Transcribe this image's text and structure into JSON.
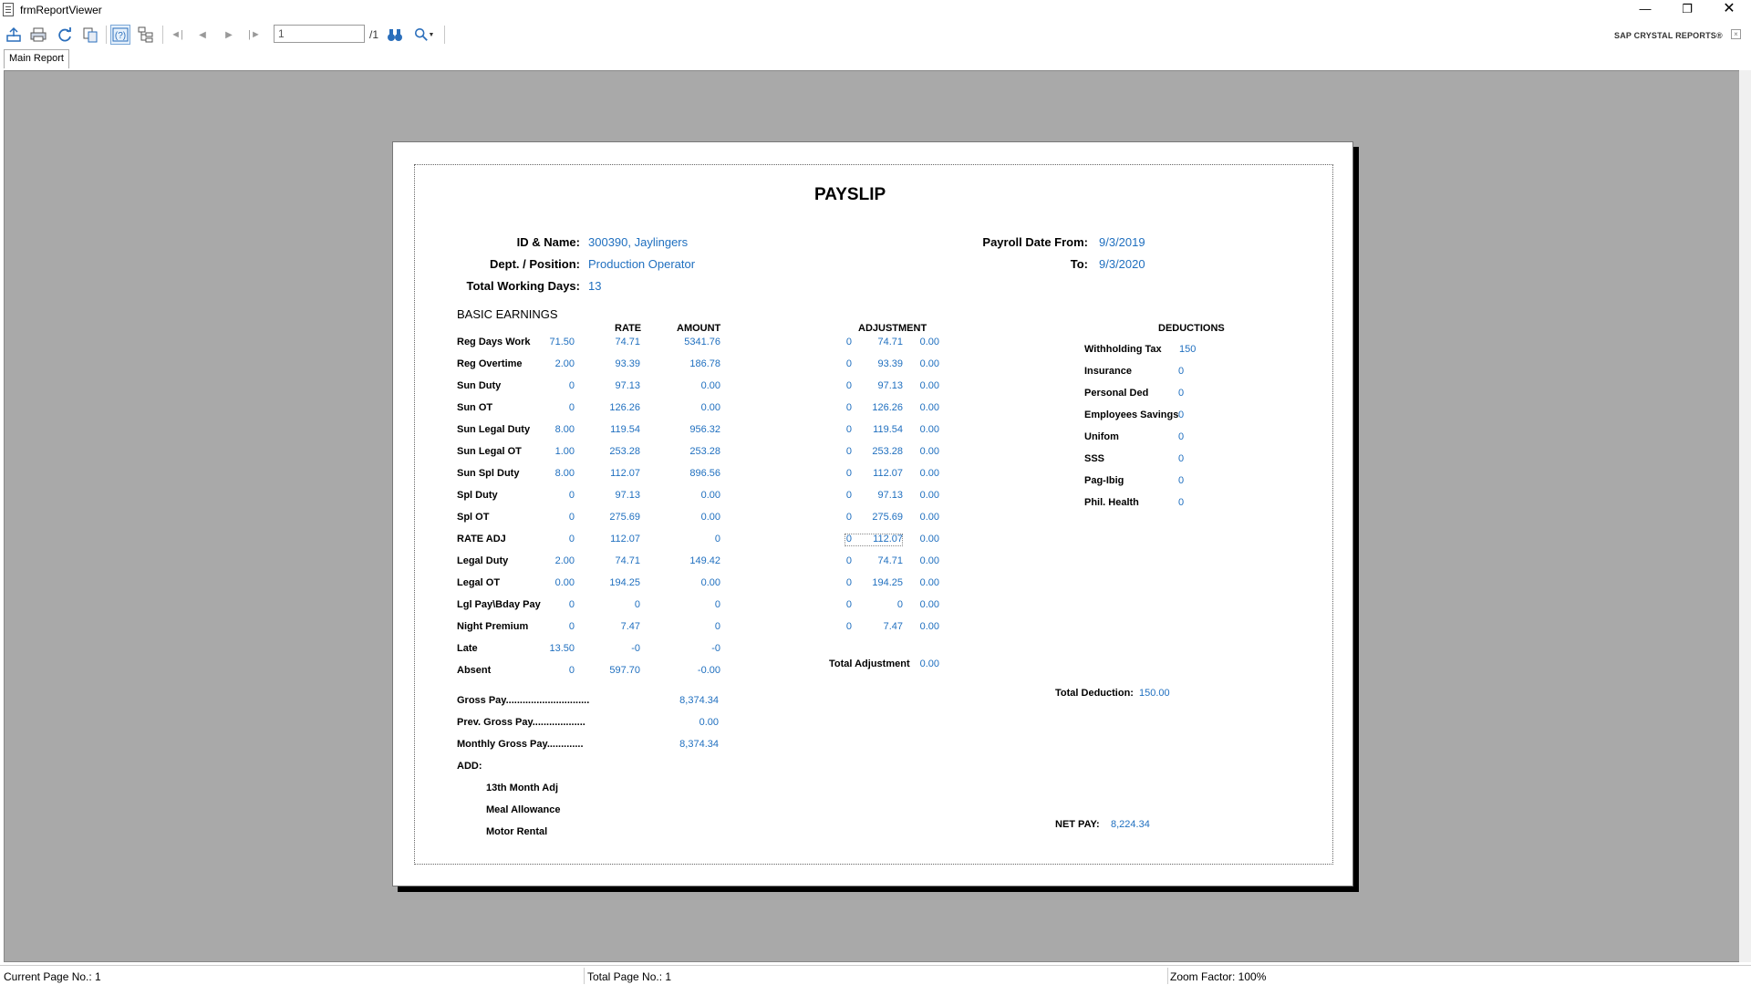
{
  "window": {
    "title": "frmReportViewer"
  },
  "toolbar": {
    "page_value": "1",
    "page_total": "/1",
    "brand": "SAP CRYSTAL REPORTS®"
  },
  "tabs": [
    {
      "label": "Main Report"
    }
  ],
  "report": {
    "title": "PAYSLIP",
    "header": {
      "id_name_label": "ID & Name:",
      "id_name_value": "300390, Jaylingers",
      "dept_label": "Dept. / Position:",
      "dept_value": "Production Operator",
      "days_label": "Total Working Days:",
      "days_value": "13",
      "date_from_label": "Payroll Date From:",
      "date_from_value": "9/3/2019",
      "date_to_label": "To:",
      "date_to_value": "9/3/2020"
    },
    "section_basic": "BASIC EARNINGS",
    "col_rate": "RATE",
    "col_amount": "AMOUNT",
    "col_adjustment": "ADJUSTMENT",
    "col_deductions": "DEDUCTIONS",
    "earnings": [
      {
        "label": "Reg Days  Work",
        "qty": "71.50",
        "rate": "74.71",
        "amount": "5341.76",
        "adj_qty": "0",
        "adj_rate": "74.71",
        "adj_amt": "0.00"
      },
      {
        "label": "Reg Overtime",
        "qty": "2.00",
        "rate": "93.39",
        "amount": "186.78",
        "adj_qty": "0",
        "adj_rate": "93.39",
        "adj_amt": "0.00"
      },
      {
        "label": "Sun Duty",
        "qty": "0",
        "rate": "97.13",
        "amount": "0.00",
        "adj_qty": "0",
        "adj_rate": "97.13",
        "adj_amt": "0.00"
      },
      {
        "label": "Sun OT",
        "qty": "0",
        "rate": "126.26",
        "amount": "0.00",
        "adj_qty": "0",
        "adj_rate": "126.26",
        "adj_amt": "0.00"
      },
      {
        "label": "Sun Legal Duty",
        "qty": "8.00",
        "rate": "119.54",
        "amount": "956.32",
        "adj_qty": "0",
        "adj_rate": "119.54",
        "adj_amt": "0.00"
      },
      {
        "label": "Sun Legal OT",
        "qty": "1.00",
        "rate": "253.28",
        "amount": "253.28",
        "adj_qty": "0",
        "adj_rate": "253.28",
        "adj_amt": "0.00"
      },
      {
        "label": "Sun Spl Duty",
        "qty": "8.00",
        "rate": "112.07",
        "amount": "896.56",
        "adj_qty": "0",
        "adj_rate": "112.07",
        "adj_amt": "0.00"
      },
      {
        "label": "Spl Duty",
        "qty": "0",
        "rate": "97.13",
        "amount": "0.00",
        "adj_qty": "0",
        "adj_rate": "97.13",
        "adj_amt": "0.00"
      },
      {
        "label": "Spl OT",
        "qty": "0",
        "rate": "275.69",
        "amount": "0.00",
        "adj_qty": "0",
        "adj_rate": "275.69",
        "adj_amt": "0.00"
      },
      {
        "label": "RATE ADJ",
        "qty": "0",
        "rate": "112.07",
        "amount": "0",
        "adj_qty": "0",
        "adj_rate": "112.07",
        "adj_amt": "0.00"
      },
      {
        "label": "Legal Duty",
        "qty": "2.00",
        "rate": "74.71",
        "amount": "149.42",
        "adj_qty": "0",
        "adj_rate": "74.71",
        "adj_amt": "0.00"
      },
      {
        "label": "Legal OT",
        "qty": "0.00",
        "rate": "194.25",
        "amount": "0.00",
        "adj_qty": "0",
        "adj_rate": "194.25",
        "adj_amt": "0.00"
      },
      {
        "label": "Lgl Pay\\Bday Pay",
        "qty": "0",
        "rate": "0",
        "amount": "0",
        "adj_qty": "0",
        "adj_rate": "0",
        "adj_amt": "0.00"
      },
      {
        "label": "Night Premium",
        "qty": "0",
        "rate": "7.47",
        "amount": "0",
        "adj_qty": "0",
        "adj_rate": "7.47",
        "adj_amt": "0.00"
      },
      {
        "label": "Late",
        "qty": "13.50",
        "rate": "-0",
        "amount": "-0"
      },
      {
        "label": "Absent",
        "qty": "0",
        "rate": "597.70",
        "amount": "-0.00"
      }
    ],
    "total_adjustment_label": "Total Adjustment",
    "total_adjustment_value": "0.00",
    "deductions": [
      {
        "label": "Withholding Tax",
        "value": "150"
      },
      {
        "label": "Insurance",
        "value": "0"
      },
      {
        "label": "Personal Ded",
        "value": "0"
      },
      {
        "label": "Employees Savings",
        "value": "0"
      },
      {
        "label": "Unifom",
        "value": "0"
      },
      {
        "label": "SSS",
        "value": "0"
      },
      {
        "label": "Pag-Ibig",
        "value": "0"
      },
      {
        "label": "Phil. Health",
        "value": "0"
      }
    ],
    "total_deduction_label": "Total Deduction:",
    "total_deduction_value": "150.00",
    "gross_pay_label": "Gross Pay..............................",
    "gross_pay_value": "8,374.34",
    "prev_gross_label": "Prev. Gross Pay...................",
    "prev_gross_value": "0.00",
    "monthly_gross_label": "Monthly Gross Pay.............",
    "monthly_gross_value": "8,374.34",
    "add_label": "ADD:",
    "add_items": [
      "13th Month Adj",
      "Meal Allowance",
      "Motor Rental"
    ],
    "net_pay_label": "NET PAY:",
    "net_pay_value": "8,224.34"
  },
  "status": {
    "current_page": "Current Page No.: 1",
    "total_page": "Total Page No.: 1",
    "zoom": "Zoom Factor: 100%"
  }
}
